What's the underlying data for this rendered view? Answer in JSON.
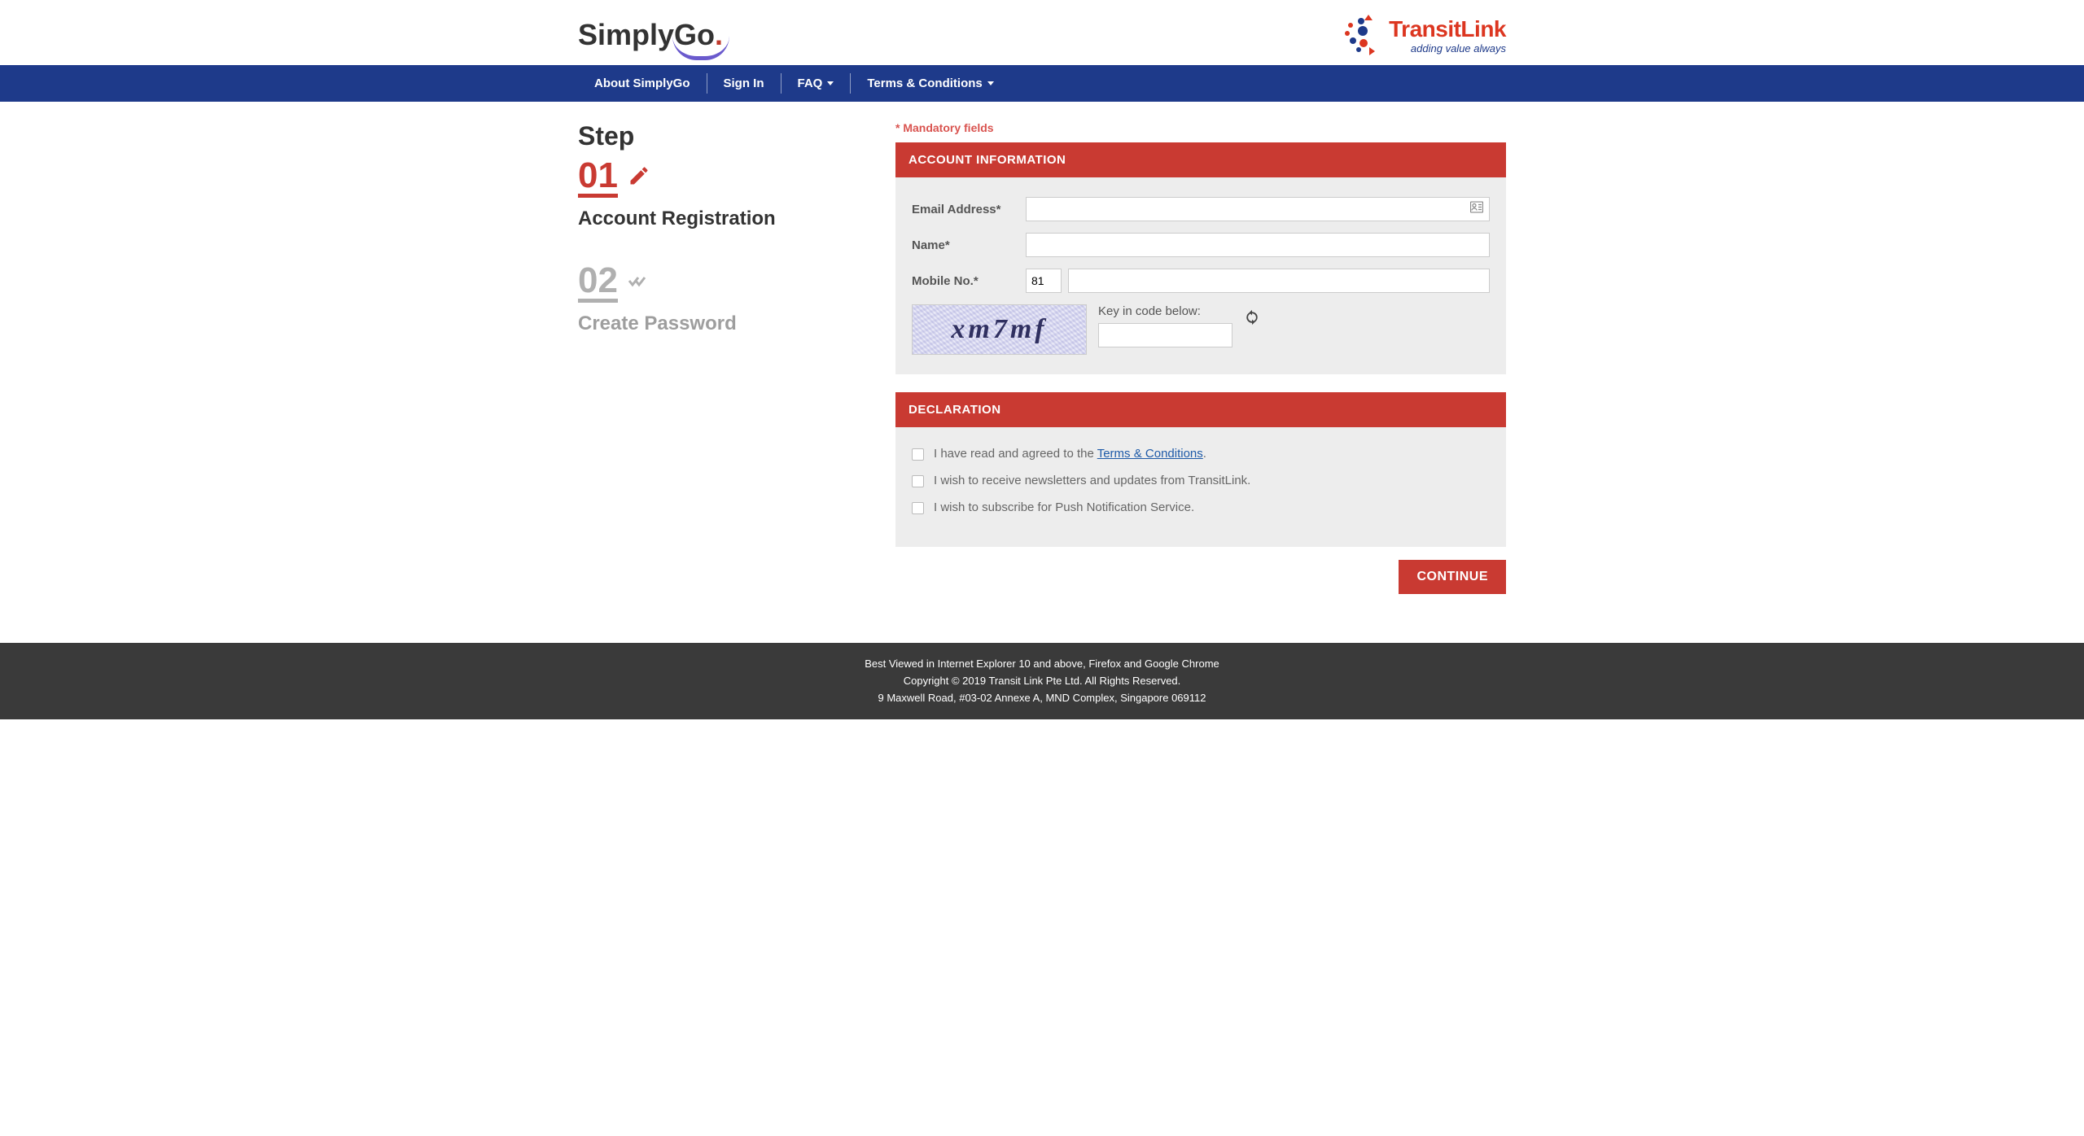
{
  "header": {
    "logo_simplygo_text": "SimplyGo",
    "logo_transitlink_main": "TransitLink",
    "logo_transitlink_sub": "adding value always"
  },
  "nav": {
    "items": [
      {
        "label": "About SimplyGo",
        "dropdown": false
      },
      {
        "label": "Sign In",
        "dropdown": false
      },
      {
        "label": "FAQ",
        "dropdown": true
      },
      {
        "label": "Terms & Conditions",
        "dropdown": true
      }
    ]
  },
  "steps": {
    "heading": "Step",
    "step1_num": "01",
    "step1_title": "Account Registration",
    "step2_num": "02",
    "step2_title": "Create Password"
  },
  "form": {
    "mandatory_note": "* Mandatory fields",
    "section_account_header": "ACCOUNT INFORMATION",
    "labels": {
      "email": "Email Address*",
      "name": "Name*",
      "mobile": "Mobile No.*"
    },
    "values": {
      "email": "",
      "name": "",
      "mobile_prefix": "81",
      "mobile": "",
      "captcha": ""
    },
    "captcha_text": "xm7mf",
    "captcha_label": "Key in code below:",
    "section_declaration_header": "DECLARATION",
    "decl1_prefix": "I have read and agreed to the ",
    "decl1_link": "Terms & Conditions",
    "decl1_suffix": ".",
    "decl2": "I wish to receive newsletters and updates from TransitLink.",
    "decl3": "I wish to subscribe for Push Notification Service.",
    "continue_label": "CONTINUE"
  },
  "footer": {
    "line1": "Best Viewed in Internet Explorer 10 and above, Firefox and Google Chrome",
    "line2": "Copyright © 2019 Transit Link Pte Ltd. All Rights Reserved.",
    "line3": "9 Maxwell Road, #03-02 Annexe A, MND Complex, Singapore 069112"
  }
}
